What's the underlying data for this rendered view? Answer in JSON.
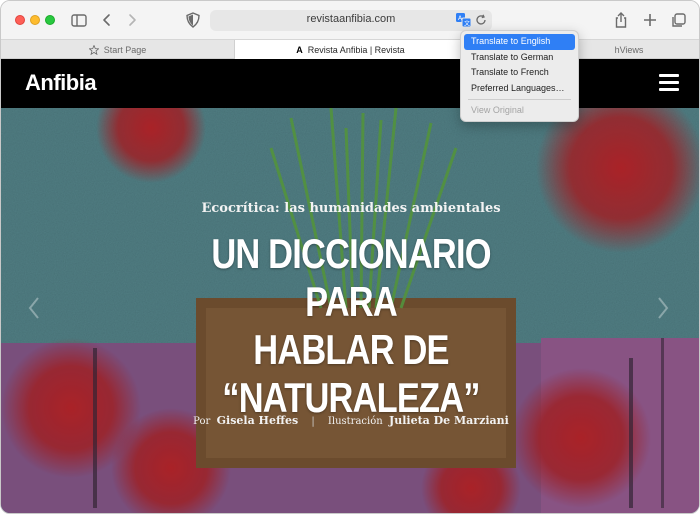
{
  "browser": {
    "address": "revistaanfibia.com",
    "tabs": [
      {
        "label": "Start Page"
      },
      {
        "label": "Revista Anfibia | Revista",
        "favicon": "A"
      },
      {
        "label": "hViews"
      }
    ]
  },
  "translate_menu": {
    "items": [
      "Translate to English",
      "Translate to German",
      "Translate to French",
      "Preferred Languages…"
    ],
    "view_original": "View Original"
  },
  "site": {
    "logo": "Anfibia"
  },
  "hero": {
    "kicker": "Ecocrítica: las humanidades ambientales",
    "headline_lines": [
      "UN DICCIONARIO PARA",
      "HABLAR DE",
      "“NATURALEZA”"
    ],
    "byline": {
      "por_label": "Por",
      "author": "Gisela Heffes",
      "sep": "|",
      "illus_label": "Ilustración",
      "illustrator": "Julieta De Marziani"
    }
  },
  "colors": {
    "accent": "#2f7ff5",
    "header_bg": "#000000",
    "hero_bg": "#5a8d93"
  }
}
